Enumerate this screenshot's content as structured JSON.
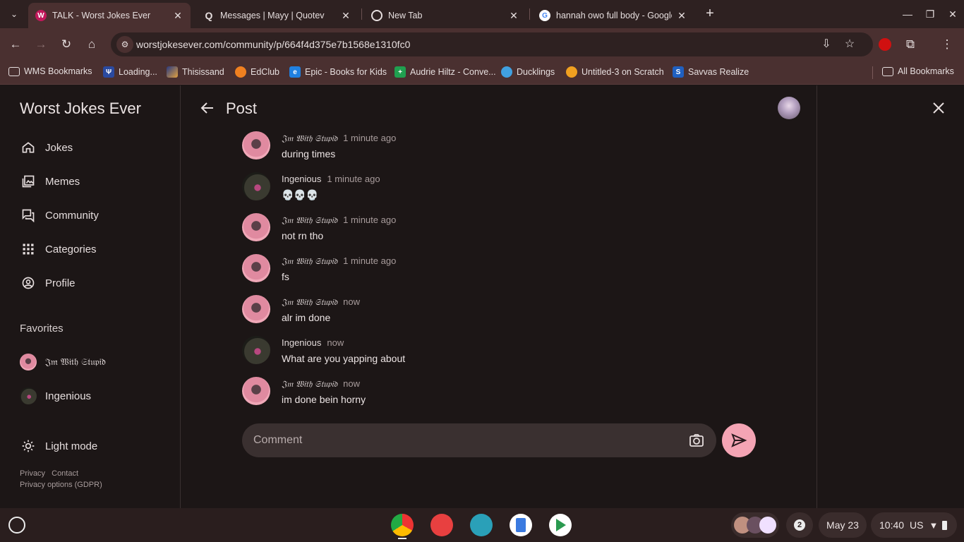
{
  "browser": {
    "tabs": [
      {
        "title": "TALK - Worst Jokes Ever",
        "active": true,
        "favicon": "W"
      },
      {
        "title": "Messages | Mayy | Quotev",
        "favicon": "Q"
      },
      {
        "title": "New Tab",
        "favicon": "chrome-icon"
      },
      {
        "title": "hannah owo full body - Google",
        "favicon": "G"
      }
    ],
    "url": "worstjokesever.com/community/p/664f4d375e7b1568e1310fc0",
    "bookmarks": [
      "WMS Bookmarks",
      "Loading...",
      "Thisissand",
      "EdClub",
      "Epic - Books for Kids",
      "Audrie Hiltz - Conve...",
      "Ducklings",
      "Untitled-3 on Scratch",
      "Savvas Realize"
    ],
    "all_bookmarks": "All Bookmarks"
  },
  "sidebar": {
    "site_title": "Worst Jokes Ever",
    "nav": [
      {
        "label": "Jokes",
        "icon": "home-icon"
      },
      {
        "label": "Memes",
        "icon": "images-icon"
      },
      {
        "label": "Community",
        "icon": "forum-icon"
      },
      {
        "label": "Categories",
        "icon": "grid-icon"
      },
      {
        "label": "Profile",
        "icon": "account-circle-icon"
      }
    ],
    "favorites_heading": "Favorites",
    "favorites": [
      {
        "name": "𝔍𝔪 𝔚𝔦𝔱𝔥 𝔖𝔱𝔲𝔭𝔦𝔡"
      },
      {
        "name": "Ingenious"
      }
    ],
    "light_mode": "Light mode",
    "footer": {
      "privacy": "Privacy",
      "contact": "Contact",
      "gdpr": "Privacy options (GDPR)"
    }
  },
  "main": {
    "title": "Post",
    "messages": [
      {
        "author": "𝔍𝔪 𝔚𝔦𝔱𝔥 𝔖𝔱𝔲𝔭𝔦𝔡",
        "time": "1 minute ago",
        "text": "during times",
        "avatar": "pink"
      },
      {
        "author": "Ingenious",
        "time": "1 minute ago",
        "text": "💀💀💀",
        "avatar": "dark"
      },
      {
        "author": "𝔍𝔪 𝔚𝔦𝔱𝔥 𝔖𝔱𝔲𝔭𝔦𝔡",
        "time": "1 minute ago",
        "text": "not rn tho",
        "avatar": "pink"
      },
      {
        "author": "𝔍𝔪 𝔚𝔦𝔱𝔥 𝔖𝔱𝔲𝔭𝔦𝔡",
        "time": "1 minute ago",
        "text": "fs",
        "avatar": "pink"
      },
      {
        "author": "𝔍𝔪 𝔚𝔦𝔱𝔥 𝔖𝔱𝔲𝔭𝔦𝔡",
        "time": "now",
        "text": "alr im done",
        "avatar": "pink"
      },
      {
        "author": "Ingenious",
        "time": "now",
        "text": "What are you yapping about",
        "avatar": "dark"
      },
      {
        "author": "𝔍𝔪 𝔚𝔦𝔱𝔥 𝔖𝔱𝔲𝔭𝔦𝔡",
        "time": "now",
        "text": "im done bein horny",
        "avatar": "pink"
      }
    ],
    "comment_placeholder": "Comment"
  },
  "shelf": {
    "notification_count": "2",
    "date": "May 23",
    "time": "10:40",
    "locale": "US"
  }
}
